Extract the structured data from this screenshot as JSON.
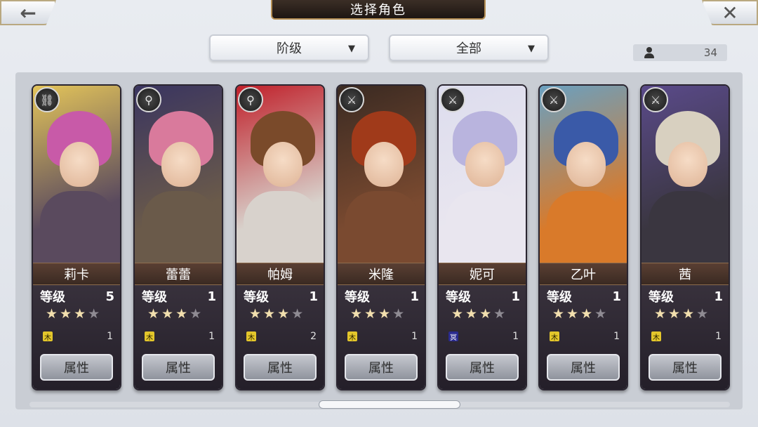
{
  "header": {
    "title": "选择角色",
    "back_icon": "←",
    "close_icon": "✕"
  },
  "filters": {
    "rank_label": "阶级",
    "category_label": "全部",
    "arrow": "▼"
  },
  "character_count": "34",
  "attr_button_label": "属性",
  "level_label": "等级",
  "cards": [
    {
      "name": "莉卡",
      "level": "5",
      "stars": 3,
      "element": "木",
      "element_count": "1",
      "class_icon": "⛓",
      "hair": "#c85aa8",
      "body": "#5a4a5e",
      "accent": "#e3c45a"
    },
    {
      "name": "蕾蕾",
      "level": "1",
      "stars": 3,
      "element": "木",
      "element_count": "1",
      "class_icon": "⚲",
      "hair": "#d97a9c",
      "body": "#6a5a4a",
      "accent": "#3a3560"
    },
    {
      "name": "帕姆",
      "level": "1",
      "stars": 3,
      "element": "木",
      "element_count": "2",
      "class_icon": "⚲",
      "hair": "#7a4a2a",
      "body": "#d8d2cc",
      "accent": "#c0202a"
    },
    {
      "name": "米隆",
      "level": "1",
      "stars": 3,
      "element": "木",
      "element_count": "1",
      "class_icon": "⚔",
      "hair": "#a03a1a",
      "body": "#7a4a30",
      "accent": "#3a2a22"
    },
    {
      "name": "妮可",
      "level": "1",
      "stars": 3,
      "element": "冥",
      "element_count": "1",
      "class_icon": "⚔",
      "hair": "#b9b4de",
      "body": "#e9e6ef",
      "accent": "#dde"
    },
    {
      "name": "乙叶",
      "level": "1",
      "stars": 3,
      "element": "木",
      "element_count": "1",
      "class_icon": "⚔",
      "hair": "#3a5aa8",
      "body": "#d97a2a",
      "accent": "#6aa0c0"
    },
    {
      "name": "茜",
      "level": "1",
      "stars": 3,
      "element": "木",
      "element_count": "1",
      "class_icon": "⚔",
      "hair": "#d8d0c0",
      "body": "#3a3640",
      "accent": "#5a4a8a"
    }
  ]
}
